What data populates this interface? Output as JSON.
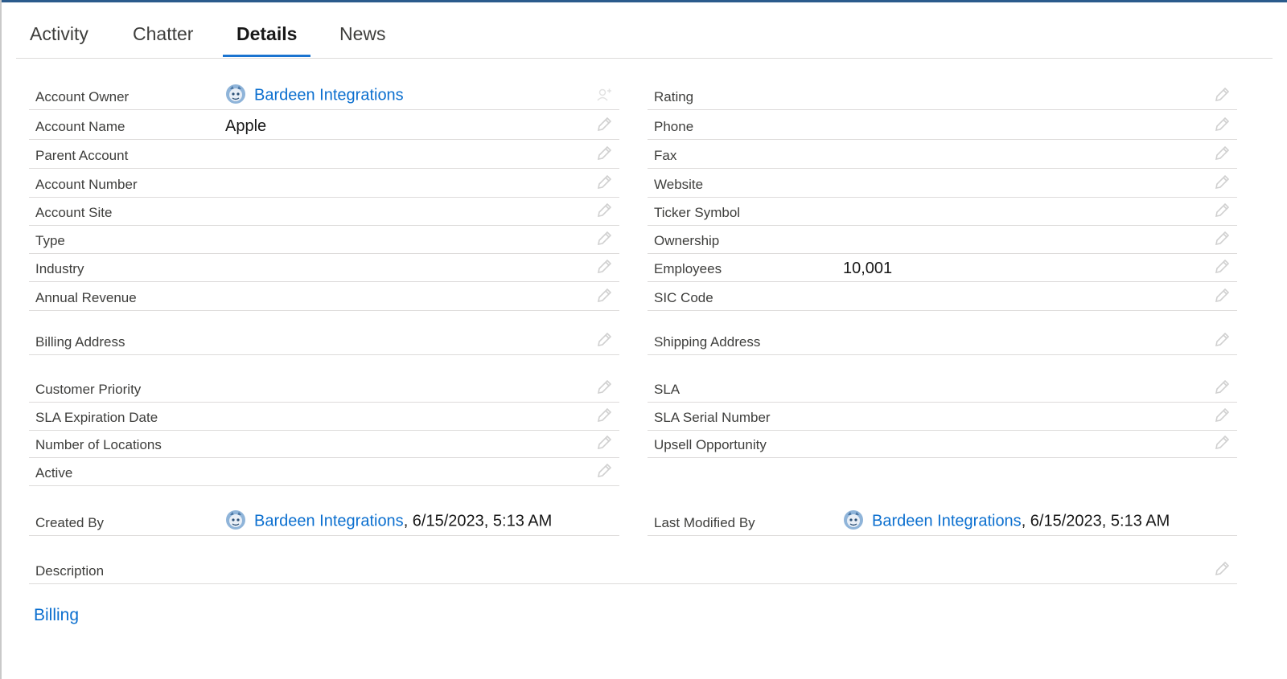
{
  "tabs": [
    {
      "label": "Activity"
    },
    {
      "label": "Chatter"
    },
    {
      "label": "Details"
    },
    {
      "label": "News"
    }
  ],
  "active_tab": "Details",
  "owner_name": "Bardeen Integrations",
  "left_fields": [
    {
      "label": "Account Owner",
      "value": ""
    },
    {
      "label": "Account Name",
      "value": "Apple"
    },
    {
      "label": "Parent Account",
      "value": ""
    },
    {
      "label": "Account Number",
      "value": ""
    },
    {
      "label": "Account Site",
      "value": ""
    },
    {
      "label": "Type",
      "value": ""
    },
    {
      "label": "Industry",
      "value": ""
    },
    {
      "label": "Annual Revenue",
      "value": ""
    },
    {
      "label": "Billing Address",
      "value": ""
    },
    {
      "label": "Customer Priority",
      "value": ""
    },
    {
      "label": "SLA Expiration Date",
      "value": ""
    },
    {
      "label": "Number of Locations",
      "value": ""
    },
    {
      "label": "Active",
      "value": ""
    }
  ],
  "right_fields": [
    {
      "label": "Rating",
      "value": ""
    },
    {
      "label": "Phone",
      "value": ""
    },
    {
      "label": "Fax",
      "value": ""
    },
    {
      "label": "Website",
      "value": ""
    },
    {
      "label": "Ticker Symbol",
      "value": ""
    },
    {
      "label": "Ownership",
      "value": ""
    },
    {
      "label": "Employees",
      "value": "10,001"
    },
    {
      "label": "SIC Code",
      "value": ""
    },
    {
      "label": "Shipping Address",
      "value": ""
    },
    {
      "label": "SLA",
      "value": ""
    },
    {
      "label": "SLA Serial Number",
      "value": ""
    },
    {
      "label": "Upsell Opportunity",
      "value": ""
    }
  ],
  "created": {
    "label": "Created By",
    "user": "Bardeen Integrations",
    "date": ", 6/15/2023, 5:13 AM"
  },
  "modified": {
    "label": "Last Modified By",
    "user": "Bardeen Integrations",
    "date": ", 6/15/2023, 5:13 AM"
  },
  "description": {
    "label": "Description",
    "value": ""
  },
  "section_link": "Billing",
  "icons": {
    "edit": "pencil-icon",
    "owner_change": "change-owner-icon",
    "avatar": "user-avatar-icon"
  },
  "colors": {
    "link": "#0b6fcf",
    "tab_active": "#1b74d0",
    "divider": "#dddbda"
  }
}
